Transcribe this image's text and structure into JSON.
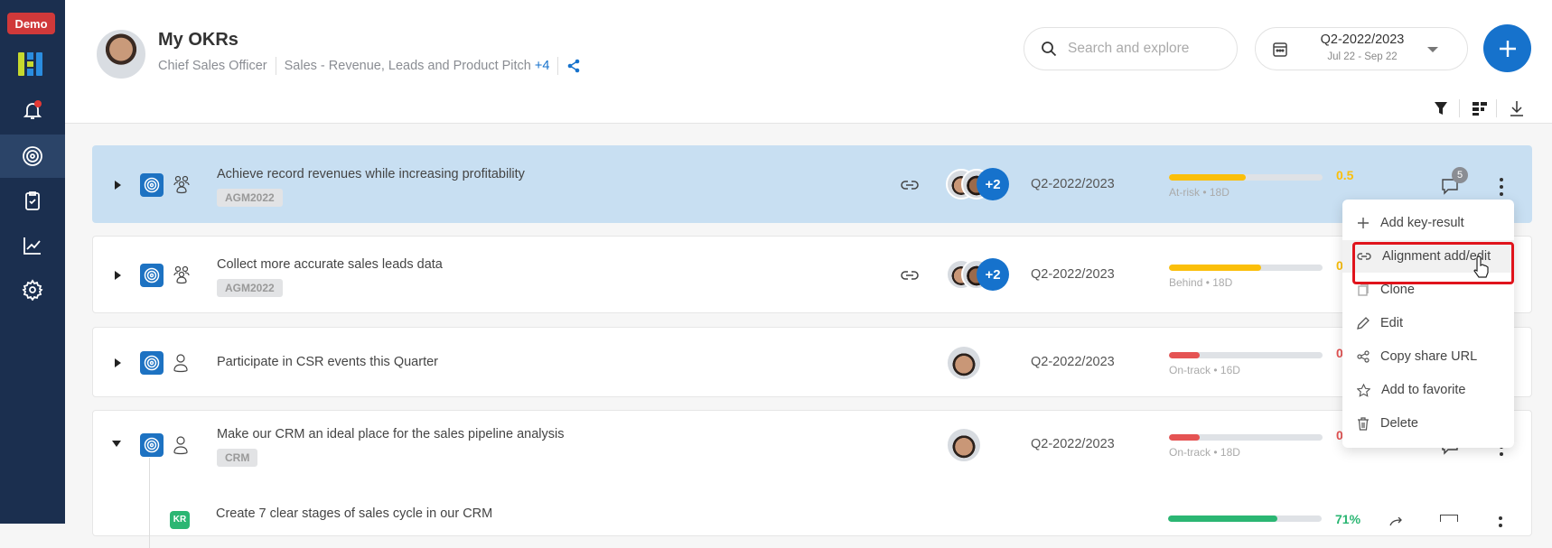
{
  "sidebar": {
    "demo_label": "Demo",
    "items": [
      {
        "icon": "bell-icon",
        "has_notification": true
      },
      {
        "icon": "target-icon",
        "active": true
      },
      {
        "icon": "clipboard-check-icon"
      },
      {
        "icon": "chart-line-icon"
      },
      {
        "icon": "gear-icon"
      }
    ]
  },
  "header": {
    "title": "My OKRs",
    "role": "Chief Sales Officer",
    "teams": "Sales - Revenue, Leads and Product Pitch",
    "teams_more": "+4"
  },
  "search": {
    "placeholder": "Search and explore"
  },
  "period_picker": {
    "period": "Q2-2022/2023",
    "range": "Jul 22 - Sep 22"
  },
  "colors": {
    "accent": "#1672cc",
    "sidebar": "#1b2f4f",
    "at_risk": "#fbbf0a",
    "behind": "#fbbf0a",
    "on_track_bar": "#e55353",
    "success": "#2bb673",
    "selected_row": "#c8dff2"
  },
  "objectives": [
    {
      "title": "Achieve record revenues while increasing profitability",
      "tag": "AGM2022",
      "owner_type": "group",
      "aligned": true,
      "extra_owners": "+2",
      "period": "Q2-2022/2023",
      "progress": 0.5,
      "value": "0.5",
      "status": "At-risk",
      "days": "18D",
      "comments": "5",
      "expanded": false,
      "selected": true
    },
    {
      "title": "Collect more accurate sales leads data",
      "tag": "AGM2022",
      "owner_type": "group",
      "aligned": true,
      "extra_owners": "+2",
      "period": "Q2-2022/2023",
      "progress": 0.6,
      "value": "0",
      "status": "Behind",
      "days": "18D",
      "expanded": false
    },
    {
      "title": "Participate in CSR events this Quarter",
      "tag": "",
      "owner_type": "individual",
      "period": "Q2-2022/2023",
      "progress": 0.2,
      "value": "0",
      "status": "On-track",
      "days": "16D",
      "expanded": false
    },
    {
      "title": "Make our CRM an ideal place for the sales pipeline analysis",
      "tag": "CRM",
      "owner_type": "individual",
      "period": "Q2-2022/2023",
      "progress": 0.2,
      "value": "0.",
      "status": "On-track",
      "days": "18D",
      "expanded": true,
      "key_results": [
        {
          "badge": "KR",
          "title": "Create 7 clear stages of sales cycle in our CRM",
          "progress": 0.71,
          "value": "71%"
        }
      ]
    }
  ],
  "context_menu": {
    "items": [
      "Add key-result",
      "Alignment add/edit",
      "Clone",
      "Edit",
      "Copy share URL",
      "Add to favorite",
      "Delete"
    ],
    "hovered": "Alignment add/edit"
  }
}
